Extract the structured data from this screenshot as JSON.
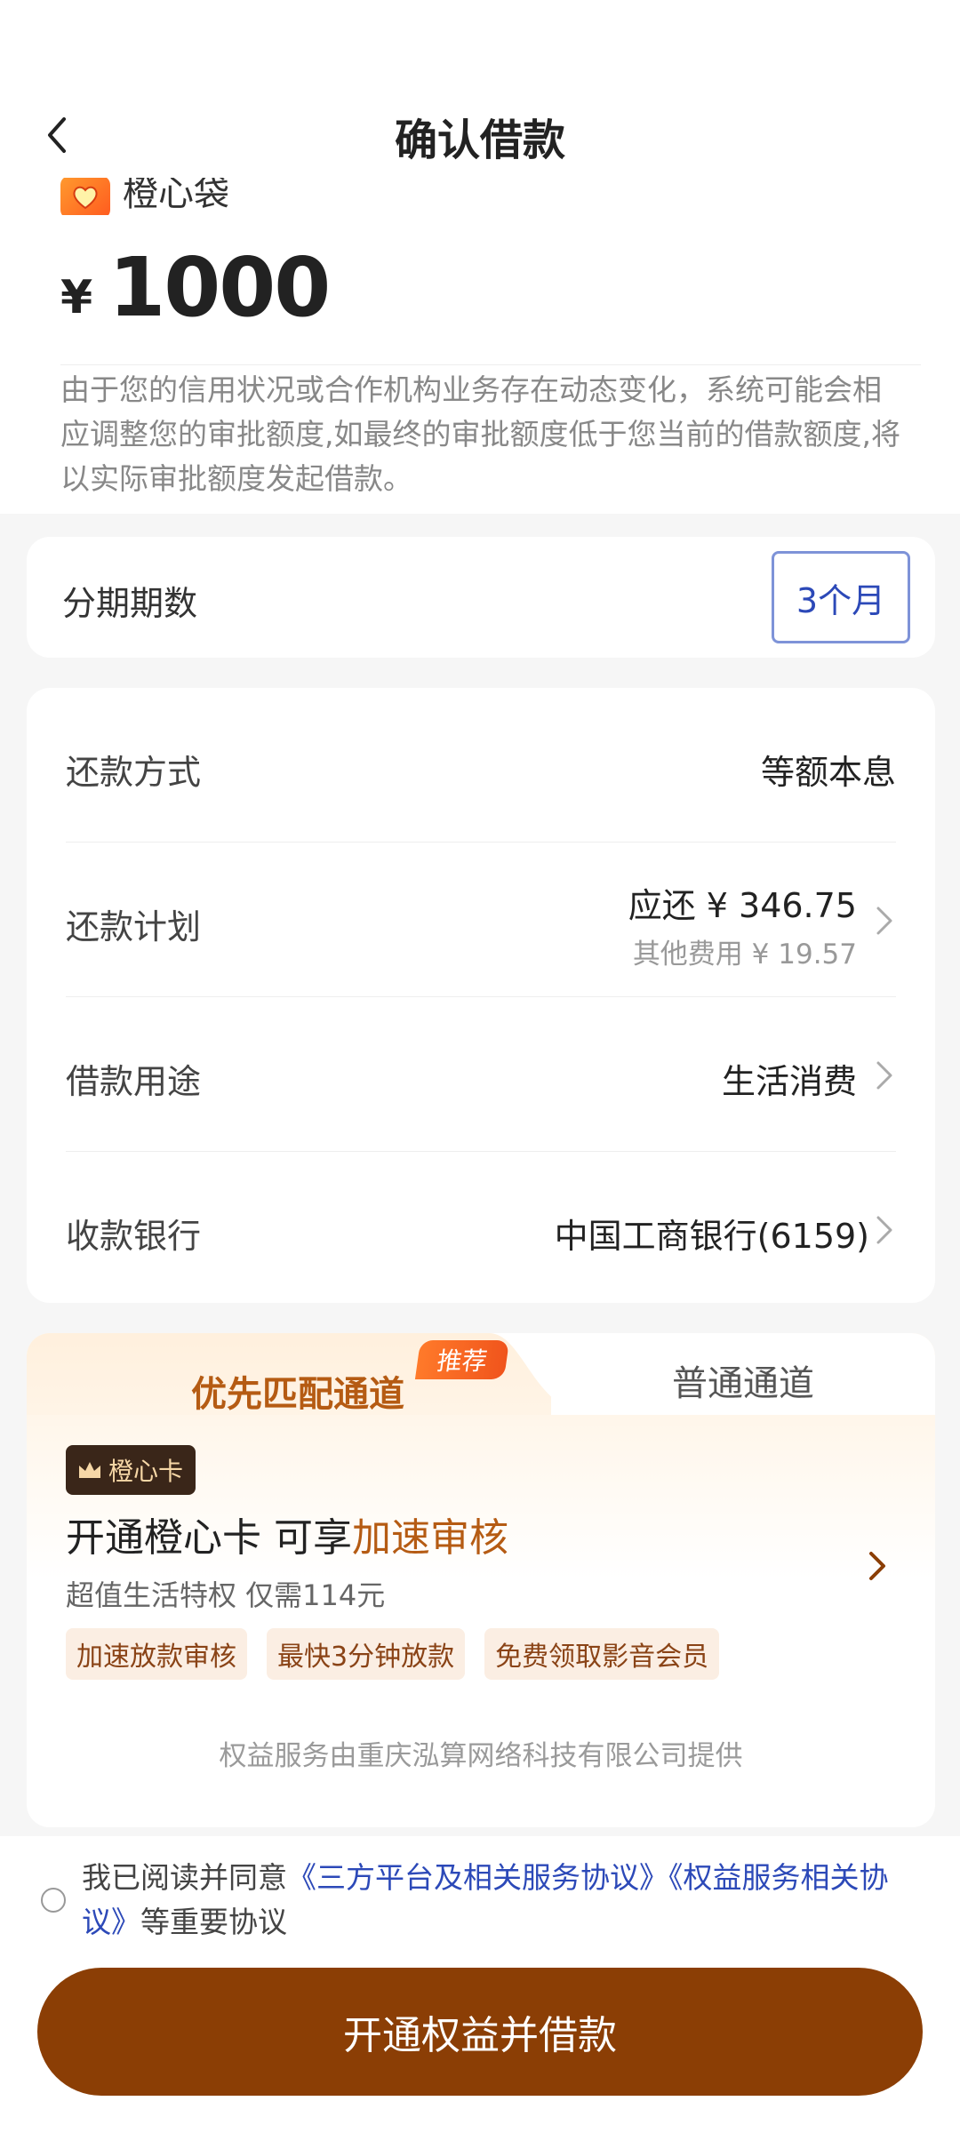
{
  "header": {
    "title": "确认借款"
  },
  "loan": {
    "brand_name": "橙心袋",
    "currency": "¥",
    "amount": "1000",
    "notice": "由于您的信用状况或合作机构业务存在动态变化，系统可能会相应调整您的审批额度,如最终的审批额度低于您当前的借款额度,将以实际审批额度发起借款。"
  },
  "term": {
    "label": "分期期数",
    "selected": "3个月"
  },
  "details": {
    "repay_method": {
      "label": "还款方式",
      "value": "等额本息"
    },
    "repay_plan": {
      "label": "还款计划",
      "main": "应还 ¥ 346.75",
      "sub": "其他费用 ¥ 19.57"
    },
    "purpose": {
      "label": "借款用途",
      "value": "生活消费"
    },
    "bank": {
      "label": "收款银行",
      "value": "中国工商银行(6159)"
    }
  },
  "channel": {
    "active_tab": "优先匹配通道",
    "badge": "推荐",
    "inactive_tab": "普通通道",
    "member_tag": "橙心卡",
    "title_prefix": "开通橙心卡 可享",
    "title_highlight": "加速审核",
    "subtitle": "超值生活特权 仅需114元",
    "chips": [
      "加速放款审核",
      "最快3分钟放款",
      "免费领取影音会员"
    ],
    "provider": "权益服务由重庆泓算网络科技有限公司提供"
  },
  "agreement": {
    "prefix": "我已阅读并同意",
    "link1": "《三方平台及相关服务协议》",
    "link2": "《权益服务相关协议》",
    "suffix": "等重要协议"
  },
  "cta": {
    "label": "开通权益并借款"
  },
  "colors": {
    "accent_brown": "#8b3e05",
    "link_blue": "#2c49b8",
    "highlight": "#b55b13"
  }
}
